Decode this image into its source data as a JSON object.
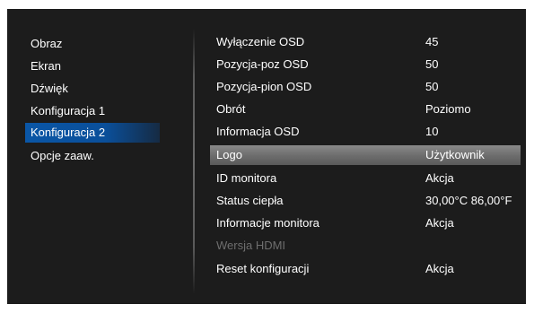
{
  "left_menu": {
    "items": [
      {
        "label": "Obraz"
      },
      {
        "label": "Ekran"
      },
      {
        "label": "Dźwięk"
      },
      {
        "label": "Konfiguracja 1"
      },
      {
        "label": "Konfiguracja 2",
        "selected": true
      },
      {
        "label": "Opcje zaaw."
      }
    ]
  },
  "settings": {
    "rows": [
      {
        "label": "Wyłączenie OSD",
        "value": "45"
      },
      {
        "label": "Pozycja-poz OSD",
        "value": "50"
      },
      {
        "label": "Pozycja-pion OSD",
        "value": "50"
      },
      {
        "label": "Obrót",
        "value": "Poziomo"
      },
      {
        "label": "Informacja OSD",
        "value": "10"
      },
      {
        "label": "Logo",
        "value": "Użytkownik",
        "highlighted": true
      },
      {
        "label": "ID monitora",
        "value": "Akcja"
      },
      {
        "label": "Status ciepła",
        "value": "30,00°C 86,00°F"
      },
      {
        "label": "Informacje monitora",
        "value": "Akcja"
      },
      {
        "label": "Wersja HDMI",
        "value": "",
        "disabled": true
      },
      {
        "label": "Reset konfiguracji",
        "value": "Akcja"
      }
    ]
  },
  "colors": {
    "background": "#1c1c1c",
    "selected_menu": "#0a56a6",
    "highlight_row": "#707070",
    "text": "#ffffff",
    "disabled_text": "#6e6e6e"
  }
}
